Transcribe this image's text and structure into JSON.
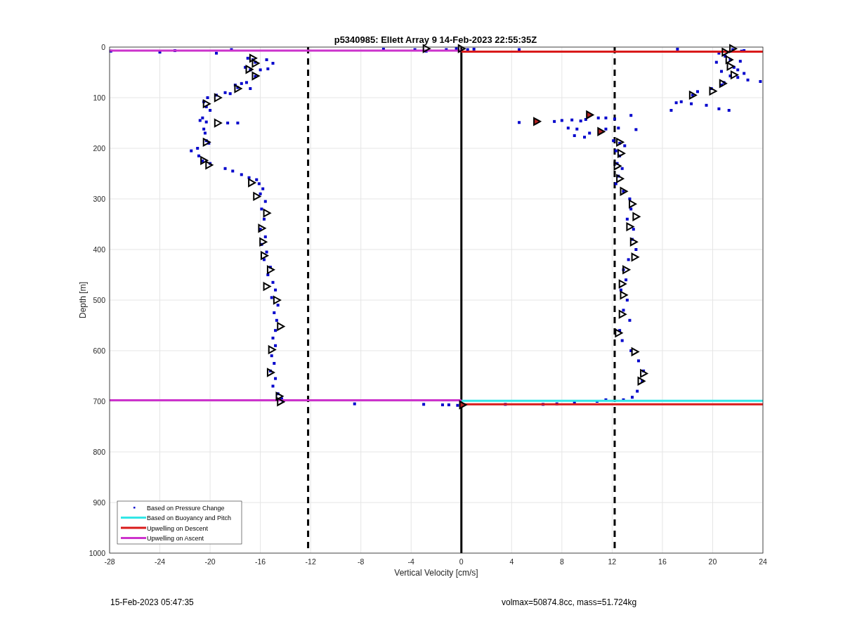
{
  "figure": {
    "chart_data": {
      "type": "scatter",
      "title": "p5340985: Ellett Array 9 14-Feb-2023 22:55:35Z",
      "xlabel": "Vertical Velocity [cm/s]",
      "ylabel": "Depth [m]",
      "xlim": [
        -28,
        24
      ],
      "ylim": [
        1000,
        0
      ],
      "xticks": [
        -28,
        -24,
        -20,
        -16,
        -12,
        -8,
        -4,
        0,
        4,
        8,
        12,
        16,
        20,
        24
      ],
      "yticks": [
        1000,
        900,
        800,
        700,
        600,
        500,
        400,
        300,
        200,
        100,
        0
      ],
      "series": [
        {
          "name": "Based on Pressure Change",
          "color": "#0000cc",
          "type": "scatter",
          "x": [
            -27.9,
            -24,
            -22.8,
            -19.5,
            -18.3,
            -17,
            -16.6,
            -16.4,
            -15.5,
            -15,
            -17.2,
            -16.8,
            -16,
            -15.4,
            -16.4,
            -17.5,
            -17.1,
            -18,
            -17.8,
            -16.8,
            -18.8,
            -19.5,
            -18.4,
            -20.2,
            -20.5,
            -20.3,
            -20,
            -20.6,
            -20.8,
            -20.3,
            -18.6,
            -17.8,
            -20.5,
            -20.4,
            -20.3,
            -20.1,
            -21,
            -21.5,
            -20.9,
            -20.6,
            -20,
            -18.8,
            -18.2,
            -17.5,
            -16.9,
            -16.3,
            -16.1,
            -15.8,
            -16,
            -15.6,
            -15.9,
            -15.7,
            -16,
            -15.6,
            -15.9,
            -15.5,
            -15.7,
            -15.2,
            -15.4,
            -15,
            -14.8,
            -15.1,
            -14.6,
            -14.9,
            -14.7,
            -14.8,
            -15,
            -14.8,
            -15.1,
            -14.9,
            -15.2,
            -14.8,
            -15,
            -14.6,
            -14.3,
            -14.2,
            -8.5,
            -3,
            -1.5,
            -1,
            -0.3,
            3.5,
            6.5,
            7.6,
            9,
            10.8,
            11.5,
            -6.2,
            -3.7,
            -2.8,
            -1.2,
            -0.4,
            0.5,
            1,
            4.6,
            17.2,
            21.6,
            22.3,
            22.5,
            20.5,
            21,
            21.4,
            22.2,
            20.3,
            21.7,
            22,
            20.7,
            22.5,
            21.4,
            22,
            23.8,
            22.8,
            20.9,
            20.7,
            19.9,
            18.8,
            18.4,
            17.1,
            17.5,
            16.7,
            18.3,
            19.5,
            20.5,
            21.3,
            4.6,
            6.1,
            7.4,
            8,
            8.8,
            9.5,
            9.9,
            10.9,
            11.5,
            12.2,
            13.5,
            8.5,
            9.2,
            10.2,
            11.5,
            12.5,
            13.9,
            9,
            9.8,
            12.1,
            12.6,
            13,
            12.3,
            12.6,
            12.4,
            12.8,
            12.5,
            12.3,
            12.9,
            13.4,
            13.5,
            13.2,
            13.7,
            13.6,
            13.9,
            13.3,
            12.9,
            13.1,
            12.7,
            13.2,
            12.9,
            13.4,
            12.6,
            12.8,
            13.5,
            14.1,
            14.5,
            14.4,
            14,
            13.6,
            12.9
          ],
          "values": [
            8,
            10,
            7,
            12,
            5,
            22,
            25,
            30,
            25,
            32,
            40,
            45,
            45,
            43,
            58,
            72,
            70,
            75,
            80,
            82,
            90,
            95,
            92,
            100,
            108,
            118,
            125,
            140,
            145,
            148,
            150,
            150,
            162,
            170,
            185,
            190,
            200,
            205,
            215,
            225,
            230,
            240,
            245,
            252,
            258,
            262,
            270,
            280,
            290,
            305,
            320,
            340,
            360,
            375,
            390,
            405,
            420,
            435,
            450,
            465,
            480,
            495,
            510,
            525,
            540,
            560,
            575,
            590,
            610,
            625,
            640,
            655,
            670,
            685,
            695,
            700,
            705,
            706,
            707,
            707,
            708,
            706,
            706,
            705,
            702,
            700,
            697,
            4,
            5,
            8,
            5,
            3,
            5,
            4,
            5,
            4,
            5,
            8,
            7,
            12,
            18,
            25,
            28,
            30,
            40,
            45,
            48,
            52,
            57,
            60,
            68,
            65,
            70,
            75,
            82,
            88,
            95,
            110,
            108,
            125,
            112,
            115,
            122,
            125,
            149,
            147,
            147,
            145,
            144,
            146,
            143,
            140,
            140,
            142,
            135,
            160,
            162,
            170,
            162,
            160,
            163,
            175,
            178,
            185,
            190,
            195,
            205,
            215,
            230,
            240,
            255,
            270,
            285,
            300,
            320,
            340,
            360,
            380,
            400,
            420,
            440,
            460,
            480,
            500,
            520,
            540,
            560,
            580,
            600,
            620,
            640,
            660,
            680,
            692,
            697
          ]
        },
        {
          "name": "Based on Buoyancy and Pitch",
          "color": "#33e6e6",
          "type": "line",
          "x": [
            0,
            24
          ],
          "values": [
            699,
            699
          ]
        },
        {
          "name": "Upwelling on Descent",
          "color": "#d91a1a",
          "type": "line",
          "x": [
            0,
            24
          ],
          "values": [
            9,
            9
          ]
        },
        {
          "name": "Upwelling on Ascent",
          "color": "#cc33cc",
          "type": "line",
          "x": [
            -28,
            0
          ],
          "values": [
            7,
            7
          ]
        },
        {
          "color": "#d91a1a",
          "type": "line",
          "x": [
            0,
            24
          ],
          "values": [
            706,
            706
          ]
        },
        {
          "color": "#cc33cc",
          "type": "line",
          "x": [
            -28,
            0
          ],
          "values": [
            698,
            698
          ]
        },
        {
          "color": "#000000",
          "type": "scatter",
          "x": [
            -2.8,
            -16.6,
            -16.4,
            -16.9,
            -16.4,
            -17.8,
            -19.4,
            -20.3,
            -19.4,
            -20.3,
            -20.5,
            -20.1,
            -16.7,
            -16.3,
            -15.5,
            -15.9,
            -15.8,
            -15.7,
            -15.2,
            -15.5,
            -14.7,
            -14.4,
            -15.1,
            -15.2,
            -14.5,
            -14.4,
            0,
            21.6,
            21,
            21.3,
            21.4,
            21.7,
            20.8,
            20,
            18.4,
            12.6,
            12.7,
            12.4,
            12.6,
            12.9,
            13.6,
            13.9,
            13.4,
            13.7,
            13.8,
            13.1,
            12.8,
            12.9,
            12.8,
            12.5,
            13.8,
            14.5,
            14.3
          ],
          "values": [
            3,
            22,
            32,
            44,
            57,
            82,
            100,
            112,
            150,
            188,
            224,
            233,
            268,
            295,
            328,
            358,
            385,
            412,
            440,
            473,
            500,
            552,
            598,
            643,
            690,
            701,
            3,
            3,
            10,
            25,
            38,
            55,
            72,
            87,
            95,
            188,
            210,
            235,
            260,
            285,
            310,
            335,
            355,
            385,
            415,
            440,
            468,
            490,
            528,
            565,
            602,
            645,
            660
          ]
        },
        {
          "color": "#b22222",
          "type": "scatter",
          "x": [
            6,
            10.2,
            11.1,
            0.1
          ],
          "values": [
            147,
            134,
            167,
            707
          ]
        }
      ],
      "ref_lines": [
        {
          "axis": "x",
          "value": -12.2
        },
        {
          "axis": "x",
          "value": 12.2
        }
      ],
      "grid": true,
      "legend": true
    },
    "footer_left": "15-Feb-2023 05:47:35",
    "footer_right": "volmax=50874.8cc, mass=51.724kg"
  }
}
